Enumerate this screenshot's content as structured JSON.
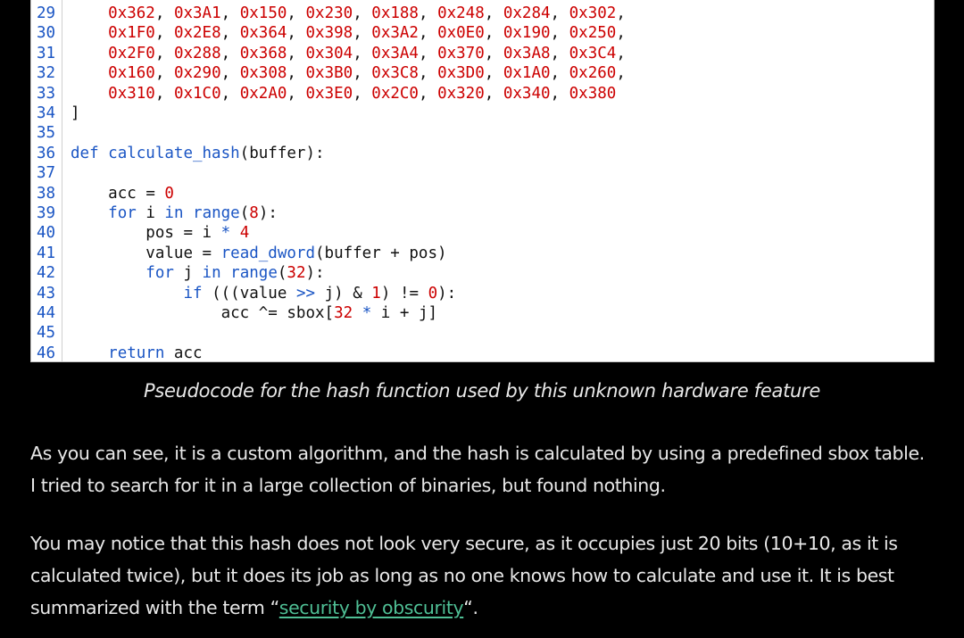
{
  "code": {
    "lines": [
      {
        "no": "29",
        "text": "    0x362, 0x3A1, 0x150, 0x230, 0x188, 0x248, 0x284, 0x302,"
      },
      {
        "no": "30",
        "text": "    0x1F0, 0x2E8, 0x364, 0x398, 0x3A2, 0x0E0, 0x190, 0x250,"
      },
      {
        "no": "31",
        "text": "    0x2F0, 0x288, 0x368, 0x304, 0x3A4, 0x370, 0x3A8, 0x3C4,"
      },
      {
        "no": "32",
        "text": "    0x160, 0x290, 0x308, 0x3B0, 0x3C8, 0x3D0, 0x1A0, 0x260,"
      },
      {
        "no": "33",
        "text": "    0x310, 0x1C0, 0x2A0, 0x3E0, 0x2C0, 0x320, 0x340, 0x380"
      },
      {
        "no": "34",
        "text": "]"
      },
      {
        "no": "35",
        "text": ""
      },
      {
        "no": "36",
        "text": "def calculate_hash(buffer):"
      },
      {
        "no": "37",
        "text": ""
      },
      {
        "no": "38",
        "text": "    acc = 0"
      },
      {
        "no": "39",
        "text": "    for i in range(8):"
      },
      {
        "no": "40",
        "text": "        pos = i * 4"
      },
      {
        "no": "41",
        "text": "        value = read_dword(buffer + pos)"
      },
      {
        "no": "42",
        "text": "        for j in range(32):"
      },
      {
        "no": "43",
        "text": "            if (((value >> j) & 1) != 0):"
      },
      {
        "no": "44",
        "text": "                acc ^= sbox[32 * i + j]"
      },
      {
        "no": "45",
        "text": ""
      },
      {
        "no": "46",
        "text": "    return acc"
      }
    ]
  },
  "caption": "Pseudocode for the hash function used by this unknown hardware feature",
  "paragraph1": "As you can see, it is a custom algorithm, and the hash is calculated by using a predefined sbox table. I tried to search for it in a large collection of binaries, but found nothing.",
  "paragraph2": {
    "before": "You may notice that this hash does not look very secure, as it occupies just 20 bits (10+10, as it is calculated twice), but it does its job as long as no one knows how to calculate and use it. It is best summarized with the term “",
    "link": "security by obscurity",
    "after": "“."
  },
  "colors": {
    "background": "#000000",
    "code_background": "#ffffff",
    "keyword": "#1a55c4",
    "number": "#cc0000",
    "link": "#4fbf95",
    "text": "#e8e8e8"
  }
}
